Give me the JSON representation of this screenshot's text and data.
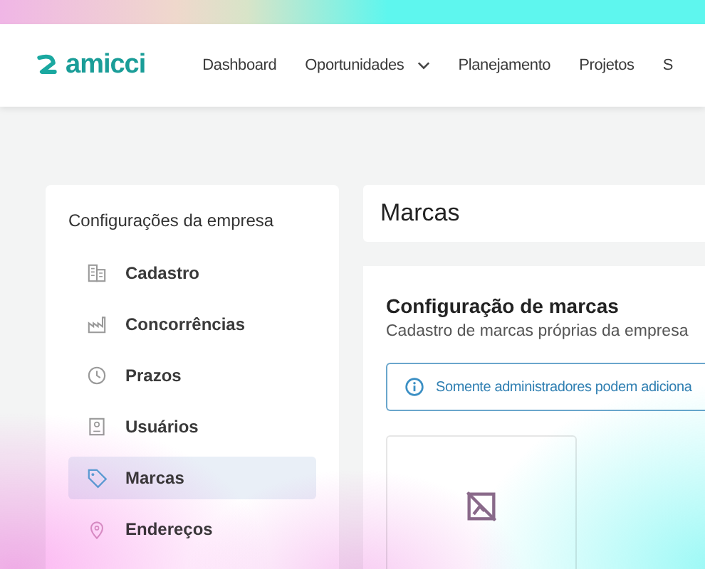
{
  "header": {
    "logo": "amicci",
    "nav": [
      {
        "label": "Dashboard",
        "has_menu": false
      },
      {
        "label": "Oportunidades",
        "has_menu": true
      },
      {
        "label": "Planejamento",
        "has_menu": false
      },
      {
        "label": "Projetos",
        "has_menu": false
      },
      {
        "label": "S",
        "has_menu": false
      }
    ]
  },
  "sidebar": {
    "title": "Configurações da empresa",
    "items": [
      {
        "label": "Cadastro",
        "selected": false
      },
      {
        "label": "Concorrências",
        "selected": false
      },
      {
        "label": "Prazos",
        "selected": false
      },
      {
        "label": "Usuários",
        "selected": false
      },
      {
        "label": "Marcas",
        "selected": true
      },
      {
        "label": "Endereços",
        "selected": false
      }
    ]
  },
  "page_title": "Marcas",
  "content": {
    "heading": "Configuração de marcas",
    "subtitle": "Cadastro de marcas próprias da empresa",
    "info": "Somente administradores podem adiciona"
  }
}
